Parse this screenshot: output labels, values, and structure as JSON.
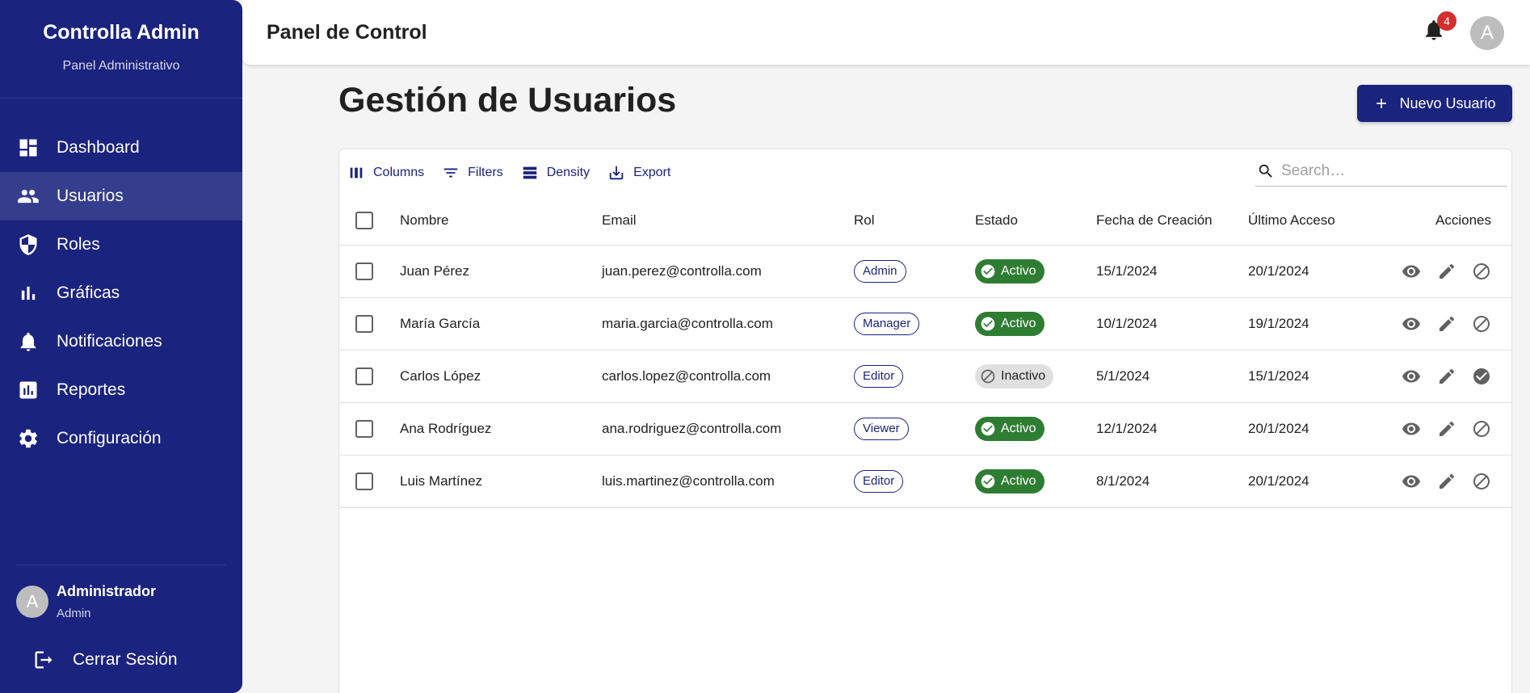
{
  "sidebar": {
    "title": "Controlla Admin",
    "subtitle": "Panel Administrativo",
    "items": [
      {
        "label": "Dashboard",
        "icon": "dashboard-icon"
      },
      {
        "label": "Usuarios",
        "icon": "people-icon",
        "active": true
      },
      {
        "label": "Roles",
        "icon": "shield-icon"
      },
      {
        "label": "Gráficas",
        "icon": "bar-chart-icon"
      },
      {
        "label": "Notificaciones",
        "icon": "bell-icon"
      },
      {
        "label": "Reportes",
        "icon": "report-icon"
      },
      {
        "label": "Configuración",
        "icon": "gear-icon"
      }
    ],
    "user": {
      "avatar": "A",
      "name": "Administrador",
      "role": "Admin"
    },
    "logout": "Cerrar Sesión"
  },
  "header": {
    "title": "Panel de Control",
    "notifications": "4",
    "avatar": "A"
  },
  "main": {
    "title": "Gestión de Usuarios",
    "new_button": "Nuevo Usuario",
    "toolbar": {
      "columns": "Columns",
      "filters": "Filters",
      "density": "Density",
      "export": "Export",
      "search_placeholder": "Search…"
    },
    "columns": [
      "Nombre",
      "Email",
      "Rol",
      "Estado",
      "Fecha de Creación",
      "Último Acceso",
      "Acciones"
    ],
    "rows": [
      {
        "name": "Juan Pérez",
        "email": "juan.perez@controlla.com",
        "role": "Admin",
        "status": "Activo",
        "active": true,
        "created": "15/1/2024",
        "last": "20/1/2024"
      },
      {
        "name": "María García",
        "email": "maria.garcia@controlla.com",
        "role": "Manager",
        "status": "Activo",
        "active": true,
        "created": "10/1/2024",
        "last": "19/1/2024"
      },
      {
        "name": "Carlos López",
        "email": "carlos.lopez@controlla.com",
        "role": "Editor",
        "status": "Inactivo",
        "active": false,
        "created": "5/1/2024",
        "last": "15/1/2024"
      },
      {
        "name": "Ana Rodríguez",
        "email": "ana.rodriguez@controlla.com",
        "role": "Viewer",
        "status": "Activo",
        "active": true,
        "created": "12/1/2024",
        "last": "20/1/2024"
      },
      {
        "name": "Luis Martínez",
        "email": "luis.martinez@controlla.com",
        "role": "Editor",
        "status": "Activo",
        "active": true,
        "created": "8/1/2024",
        "last": "20/1/2024"
      }
    ]
  },
  "colors": {
    "primary": "#1a237e",
    "success": "#2e7d32",
    "badge": "#d32f2f"
  }
}
